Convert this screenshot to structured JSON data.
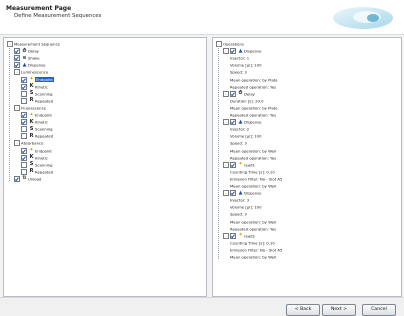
{
  "header": {
    "title": "Measurement Page",
    "subtitle": "Define Measurement Sequences"
  },
  "left_tree": [
    {
      "depth": 0,
      "expander": "-",
      "checkbox": false,
      "icon": "",
      "label": "Measurement Sequence"
    },
    {
      "depth": 1,
      "expander": "",
      "checkbox": true,
      "icon": "⏱",
      "label": "Delay"
    },
    {
      "depth": 1,
      "expander": "",
      "checkbox": true,
      "icon": "≡",
      "label": "Shake"
    },
    {
      "depth": 1,
      "expander": "",
      "checkbox": true,
      "icon": "▲",
      "label": "Dispense"
    },
    {
      "depth": 1,
      "expander": "-",
      "checkbox": false,
      "icon": "",
      "label": "Luminescence"
    },
    {
      "depth": 2,
      "expander": "",
      "checkbox": true,
      "icon": "✦",
      "label": "Endpoint",
      "selected": true
    },
    {
      "depth": 2,
      "expander": "",
      "checkbox": true,
      "icon": "K",
      "label": "Kinetic"
    },
    {
      "depth": 2,
      "expander": "",
      "checkbox": false,
      "icon": "S",
      "label": "Scanning"
    },
    {
      "depth": 2,
      "expander": "",
      "checkbox": false,
      "icon": "R",
      "label": "Repeated"
    },
    {
      "depth": 1,
      "expander": "-",
      "checkbox": false,
      "icon": "",
      "label": "Fluorescence"
    },
    {
      "depth": 2,
      "expander": "",
      "checkbox": true,
      "icon": "✦",
      "label": "Endpoint"
    },
    {
      "depth": 2,
      "expander": "",
      "checkbox": true,
      "icon": "K",
      "label": "Kinetic"
    },
    {
      "depth": 2,
      "expander": "",
      "checkbox": false,
      "icon": "S",
      "label": "Scanning"
    },
    {
      "depth": 2,
      "expander": "",
      "checkbox": false,
      "icon": "R",
      "label": "Repeated"
    },
    {
      "depth": 1,
      "expander": "-",
      "checkbox": false,
      "icon": "",
      "label": "Absorbance"
    },
    {
      "depth": 2,
      "expander": "",
      "checkbox": true,
      "icon": "✦",
      "label": "Endpoint"
    },
    {
      "depth": 2,
      "expander": "",
      "checkbox": true,
      "icon": "K",
      "label": "Kinetic"
    },
    {
      "depth": 2,
      "expander": "",
      "checkbox": false,
      "icon": "S",
      "label": "Scanning"
    },
    {
      "depth": 2,
      "expander": "",
      "checkbox": false,
      "icon": "R",
      "label": "Repeated"
    },
    {
      "depth": 1,
      "expander": "",
      "checkbox": true,
      "icon": "⇅",
      "label": "Unload"
    }
  ],
  "right_tree": [
    {
      "depth": 0,
      "expander": "-",
      "checkbox": false,
      "icon": "",
      "label": "Operations"
    },
    {
      "depth": 1,
      "expander": "-",
      "checkbox": true,
      "icon": "▲",
      "label": "Dispense"
    },
    {
      "depth": 2,
      "prop": true,
      "label": "Injector: 1"
    },
    {
      "depth": 2,
      "prop": true,
      "label": "Volume [µl]: 100"
    },
    {
      "depth": 2,
      "prop": true,
      "label": "Speed: 3"
    },
    {
      "depth": 2,
      "prop": true,
      "label": "Mean operation: by Plate"
    },
    {
      "depth": 2,
      "prop": true,
      "label": "Repeated operation: Yes"
    },
    {
      "depth": 1,
      "expander": "-",
      "checkbox": true,
      "icon": "⏱",
      "label": "Delay"
    },
    {
      "depth": 2,
      "prop": true,
      "label": "Duration [s]: 20.0"
    },
    {
      "depth": 2,
      "prop": true,
      "label": "Mean operation: by Plate"
    },
    {
      "depth": 2,
      "prop": true,
      "label": "Repeated operation: Yes"
    },
    {
      "depth": 1,
      "expander": "-",
      "checkbox": true,
      "icon": "▲",
      "label": "Dispense"
    },
    {
      "depth": 2,
      "prop": true,
      "label": "Injector: 2"
    },
    {
      "depth": 2,
      "prop": true,
      "label": "Volume [µl]: 100"
    },
    {
      "depth": 2,
      "prop": true,
      "label": "Speed: 3"
    },
    {
      "depth": 2,
      "prop": true,
      "label": "Mean operation: by Well"
    },
    {
      "depth": 2,
      "prop": true,
      "label": "Repeated operation: Yes"
    },
    {
      "depth": 1,
      "expander": "-",
      "checkbox": true,
      "icon": "✦",
      "label": "read1"
    },
    {
      "depth": 2,
      "prop": true,
      "label": "Counting Time [s]: 0.10"
    },
    {
      "depth": 2,
      "prop": true,
      "label": "Emission Filter: No - Slot A5"
    },
    {
      "depth": 2,
      "prop": true,
      "label": "Mean operation: by Well"
    },
    {
      "depth": 1,
      "expander": "-",
      "checkbox": true,
      "icon": "▲",
      "label": "Dispense"
    },
    {
      "depth": 2,
      "prop": true,
      "label": "Injector: 3"
    },
    {
      "depth": 2,
      "prop": true,
      "label": "Volume [µl]: 100"
    },
    {
      "depth": 2,
      "prop": true,
      "label": "Speed: 3"
    },
    {
      "depth": 2,
      "prop": true,
      "label": "Mean operation: by Well"
    },
    {
      "depth": 2,
      "prop": true,
      "label": "Repeated operation: Yes"
    },
    {
      "depth": 1,
      "expander": "-",
      "checkbox": true,
      "icon": "✦",
      "label": "read2"
    },
    {
      "depth": 2,
      "prop": true,
      "label": "Counting Time [s]: 0.10"
    },
    {
      "depth": 2,
      "prop": true,
      "label": "Emission Filter: No - Slot A5"
    },
    {
      "depth": 2,
      "prop": true,
      "label": "Mean operation: by Well"
    }
  ],
  "footer": {
    "back_label": "< Back",
    "next_label": "Next >",
    "cancel_label": "Cancel"
  },
  "colors": {
    "selection": "#1c62c7",
    "dispense_icon": "#1d4fb0",
    "read_icon": "#d99a00"
  }
}
